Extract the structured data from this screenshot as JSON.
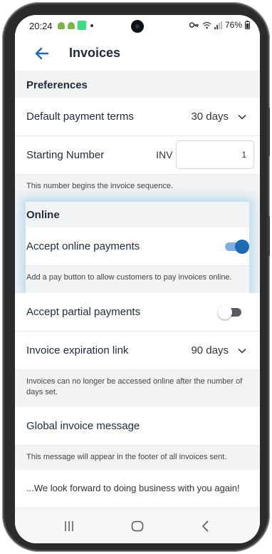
{
  "status_bar": {
    "time": "20:24",
    "battery": "76%"
  },
  "app_bar": {
    "title": "Invoices",
    "back_icon": "arrow-left-icon"
  },
  "preferences": {
    "section_title": "Preferences",
    "default_payment_terms": {
      "label": "Default payment terms",
      "value": "30 days"
    },
    "starting_number": {
      "label": "Starting Number",
      "prefix": "INV -",
      "value": "1"
    },
    "starting_number_help": "This number begins the invoice sequence."
  },
  "online": {
    "section_title": "Online",
    "accept_online_payments": {
      "label": "Accept online payments",
      "enabled": true
    },
    "accept_online_help": "Add a pay button to allow customers to pay invoices online.",
    "accept_partial_payments": {
      "label": "Accept partial payments",
      "enabled": false
    },
    "invoice_expiration": {
      "label": "Invoice expiration link",
      "value": "90 days"
    },
    "invoice_expiration_help": "Invoices can no longer be accessed online after the number of days set."
  },
  "global_message": {
    "label": "Global invoice message",
    "help": "This message will appear in the footer of all invoices sent.",
    "value": "...We look forward to doing business with you again!"
  },
  "colors": {
    "accent": "#1c6bb0",
    "background": "#f2f3f5",
    "title": "#1f2b3a"
  }
}
